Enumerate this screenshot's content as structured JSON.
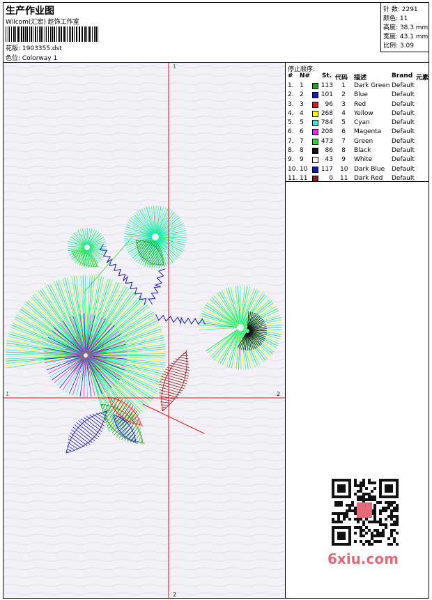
{
  "header": {
    "title": "生产作业图",
    "company": "Wilcom(汇宏) 趁饰工作室",
    "design_label": "花版: 1903355.dst",
    "colorway_label": "色位:  Colorway 1"
  },
  "stats": {
    "stitches": "针 数: 2291",
    "colors": "颜色: 11",
    "height": "高度: 38.3 mm",
    "width": "宽度: 43.1 mm",
    "scale": "比例: 3.09"
  },
  "stop_sequence": {
    "title": "停止顺序:",
    "columns": [
      "#",
      "N#",
      "St.",
      "代码",
      "描述",
      "Brand",
      "元素"
    ],
    "rows": [
      {
        "idx": "1.",
        "n": "1",
        "color": "#1aa21a",
        "st": "113",
        "code": "1",
        "desc": "Dark Green",
        "brand": "Default"
      },
      {
        "idx": "2.",
        "n": "2",
        "color": "#1a1acc",
        "st": "101",
        "code": "2",
        "desc": "Blue",
        "brand": "Default"
      },
      {
        "idx": "3.",
        "n": "3",
        "color": "#ee1111",
        "st": "96",
        "code": "3",
        "desc": "Red",
        "brand": "Default"
      },
      {
        "idx": "4.",
        "n": "4",
        "color": "#ffff00",
        "st": "268",
        "code": "4",
        "desc": "Yellow",
        "brand": "Default"
      },
      {
        "idx": "5.",
        "n": "5",
        "color": "#22eeee",
        "st": "784",
        "code": "5",
        "desc": "Cyan",
        "brand": "Default"
      },
      {
        "idx": "6.",
        "n": "6",
        "color": "#ee22ee",
        "st": "208",
        "code": "6",
        "desc": "Magenta",
        "brand": "Default"
      },
      {
        "idx": "7.",
        "n": "7",
        "color": "#22dd22",
        "st": "473",
        "code": "7",
        "desc": "Green",
        "brand": "Default"
      },
      {
        "idx": "8.",
        "n": "8",
        "color": "#111111",
        "st": "86",
        "code": "8",
        "desc": "Black",
        "brand": "Default"
      },
      {
        "idx": "9.",
        "n": "9",
        "color": "#ffffff",
        "st": "43",
        "code": "9",
        "desc": "White",
        "brand": "Default"
      },
      {
        "idx": "10.",
        "n": "10",
        "color": "#1a1aaa",
        "st": "117",
        "code": "10",
        "desc": "Dark Blue",
        "brand": "Default"
      },
      {
        "idx": "11.",
        "n": "11",
        "color": "#8b1a1a",
        "st": "0",
        "code": "11",
        "desc": "Dark Red",
        "brand": "Default"
      }
    ]
  },
  "axes": {
    "top_label": "1",
    "bottom_label": "2",
    "left_label": "1",
    "right_label": "2"
  },
  "watermark": {
    "text": "6xiu.com"
  }
}
